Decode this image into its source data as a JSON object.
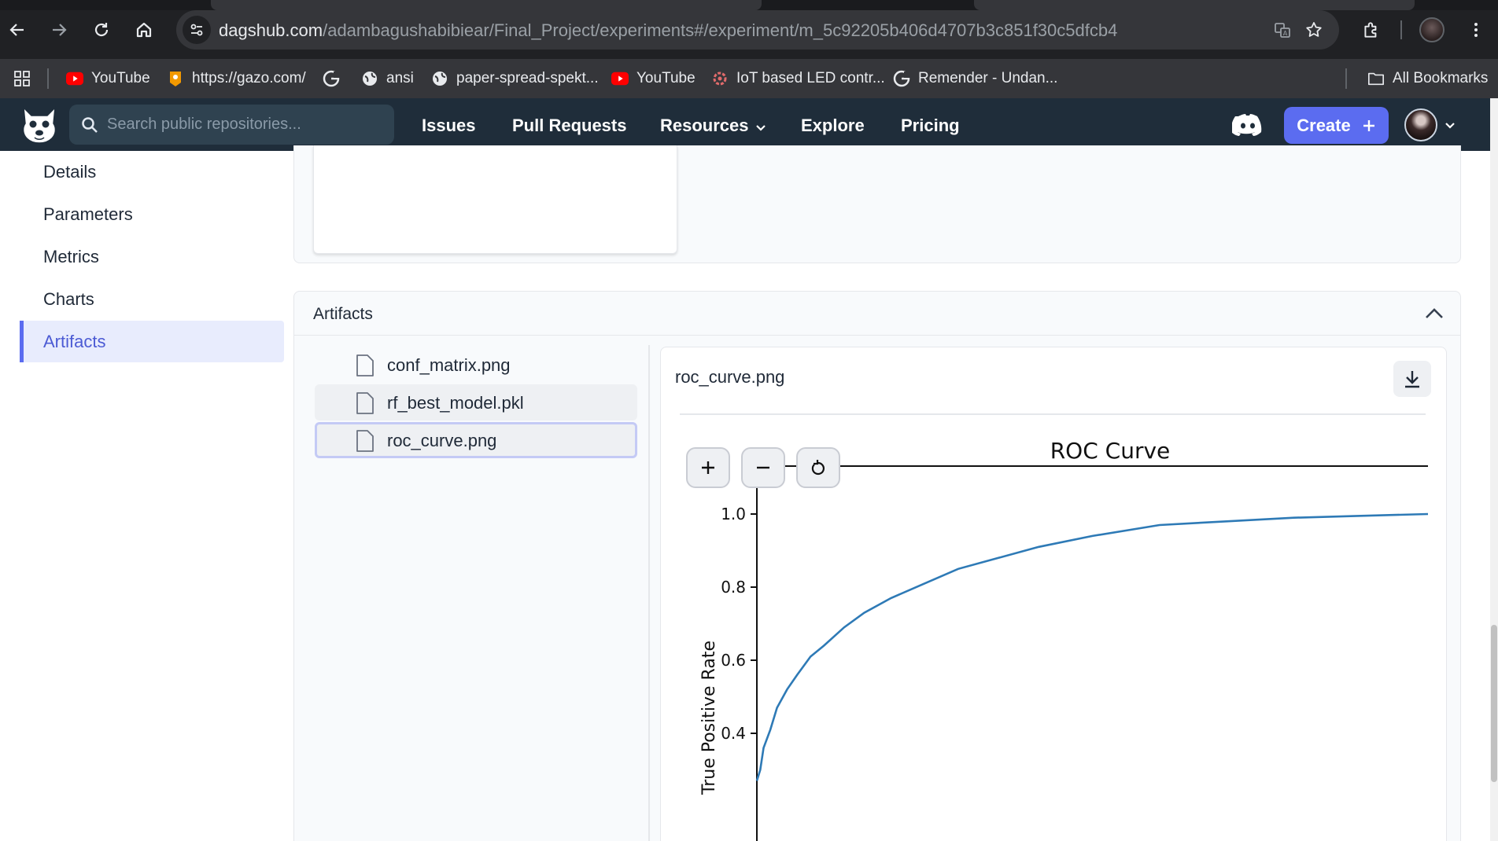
{
  "browser": {
    "url_domain": "dagshub.com",
    "url_path": "/adambagushabibiear/Final_Project/experiments#/experiment/m_5c92205b406d4707b3c851f30c5dfcb4",
    "bookmarks": [
      {
        "label": "YouTube",
        "icon": "youtube-icon"
      },
      {
        "label": "https://gazo.com/",
        "icon": "gazo-icon"
      },
      {
        "label": "",
        "icon": "google-icon"
      },
      {
        "label": "ansi",
        "icon": "globe-icon"
      },
      {
        "label": "paper-spread-spekt...",
        "icon": "globe-icon"
      },
      {
        "label": "YouTube",
        "icon": "youtube-icon"
      },
      {
        "label": "IoT based LED contr...",
        "icon": "iot-icon"
      },
      {
        "label": "Remender - Undan...",
        "icon": "google-icon"
      }
    ],
    "all_bookmarks": "All Bookmarks"
  },
  "navbar": {
    "search_placeholder": "Search public repositories...",
    "links": [
      "Issues",
      "Pull Requests",
      "Resources",
      "Explore",
      "Pricing"
    ],
    "create_label": "Create"
  },
  "sidebar": {
    "items": [
      "Details",
      "Parameters",
      "Metrics",
      "Charts",
      "Artifacts"
    ],
    "active": "Artifacts"
  },
  "artifacts": {
    "title": "Artifacts",
    "files": [
      "conf_matrix.png",
      "rf_best_model.pkl",
      "roc_curve.png"
    ],
    "selected_file": "roc_curve.png",
    "preview_title": "roc_curve.png"
  },
  "chart_data": {
    "type": "line",
    "title": "ROC Curve",
    "xlabel": "",
    "ylabel": "True Positive Rate",
    "yticks": [
      "1.0",
      "0.8",
      "0.6",
      "0.4"
    ],
    "ylim": [
      0.27,
      1.05
    ],
    "xlim": [
      0,
      1
    ],
    "color": "#2e7ab6",
    "series": [
      {
        "x": [
          0.0,
          0.005,
          0.01,
          0.02,
          0.03,
          0.045,
          0.06,
          0.08,
          0.1,
          0.13,
          0.16,
          0.2,
          0.25,
          0.3,
          0.36,
          0.42,
          0.5,
          0.6,
          0.7,
          0.8,
          0.9,
          1.0
        ],
        "y": [
          0.27,
          0.3,
          0.36,
          0.41,
          0.47,
          0.52,
          0.56,
          0.61,
          0.64,
          0.69,
          0.73,
          0.77,
          0.81,
          0.85,
          0.88,
          0.91,
          0.94,
          0.97,
          0.98,
          0.99,
          0.995,
          1.0
        ]
      }
    ]
  }
}
